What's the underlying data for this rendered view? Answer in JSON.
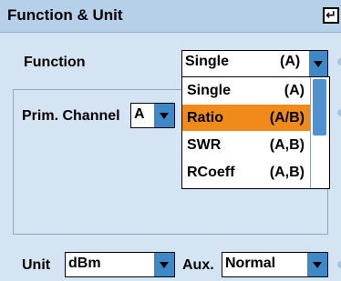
{
  "window": {
    "title": "Function & Unit"
  },
  "function": {
    "label": "Function",
    "value": "Single",
    "value_suffix": "(A)"
  },
  "dropdown": {
    "items": [
      {
        "name": "Single",
        "suffix": "(A)",
        "selected": false
      },
      {
        "name": "Ratio",
        "suffix": "(A/B)",
        "selected": true
      },
      {
        "name": "SWR",
        "suffix": "(A,B)",
        "selected": false
      },
      {
        "name": "RCoeff",
        "suffix": "(A,B)",
        "selected": false
      }
    ]
  },
  "prim_channel": {
    "label": "Prim. Channel",
    "value": "A"
  },
  "unit": {
    "label": "Unit",
    "value": "dBm"
  },
  "aux": {
    "label": "Aux.",
    "value": "Normal"
  },
  "colors": {
    "titlebar": "#b5d0e8",
    "background": "#d5e4f2",
    "dropdown_button": "#3f88c8",
    "highlight": "#f08a1a"
  }
}
